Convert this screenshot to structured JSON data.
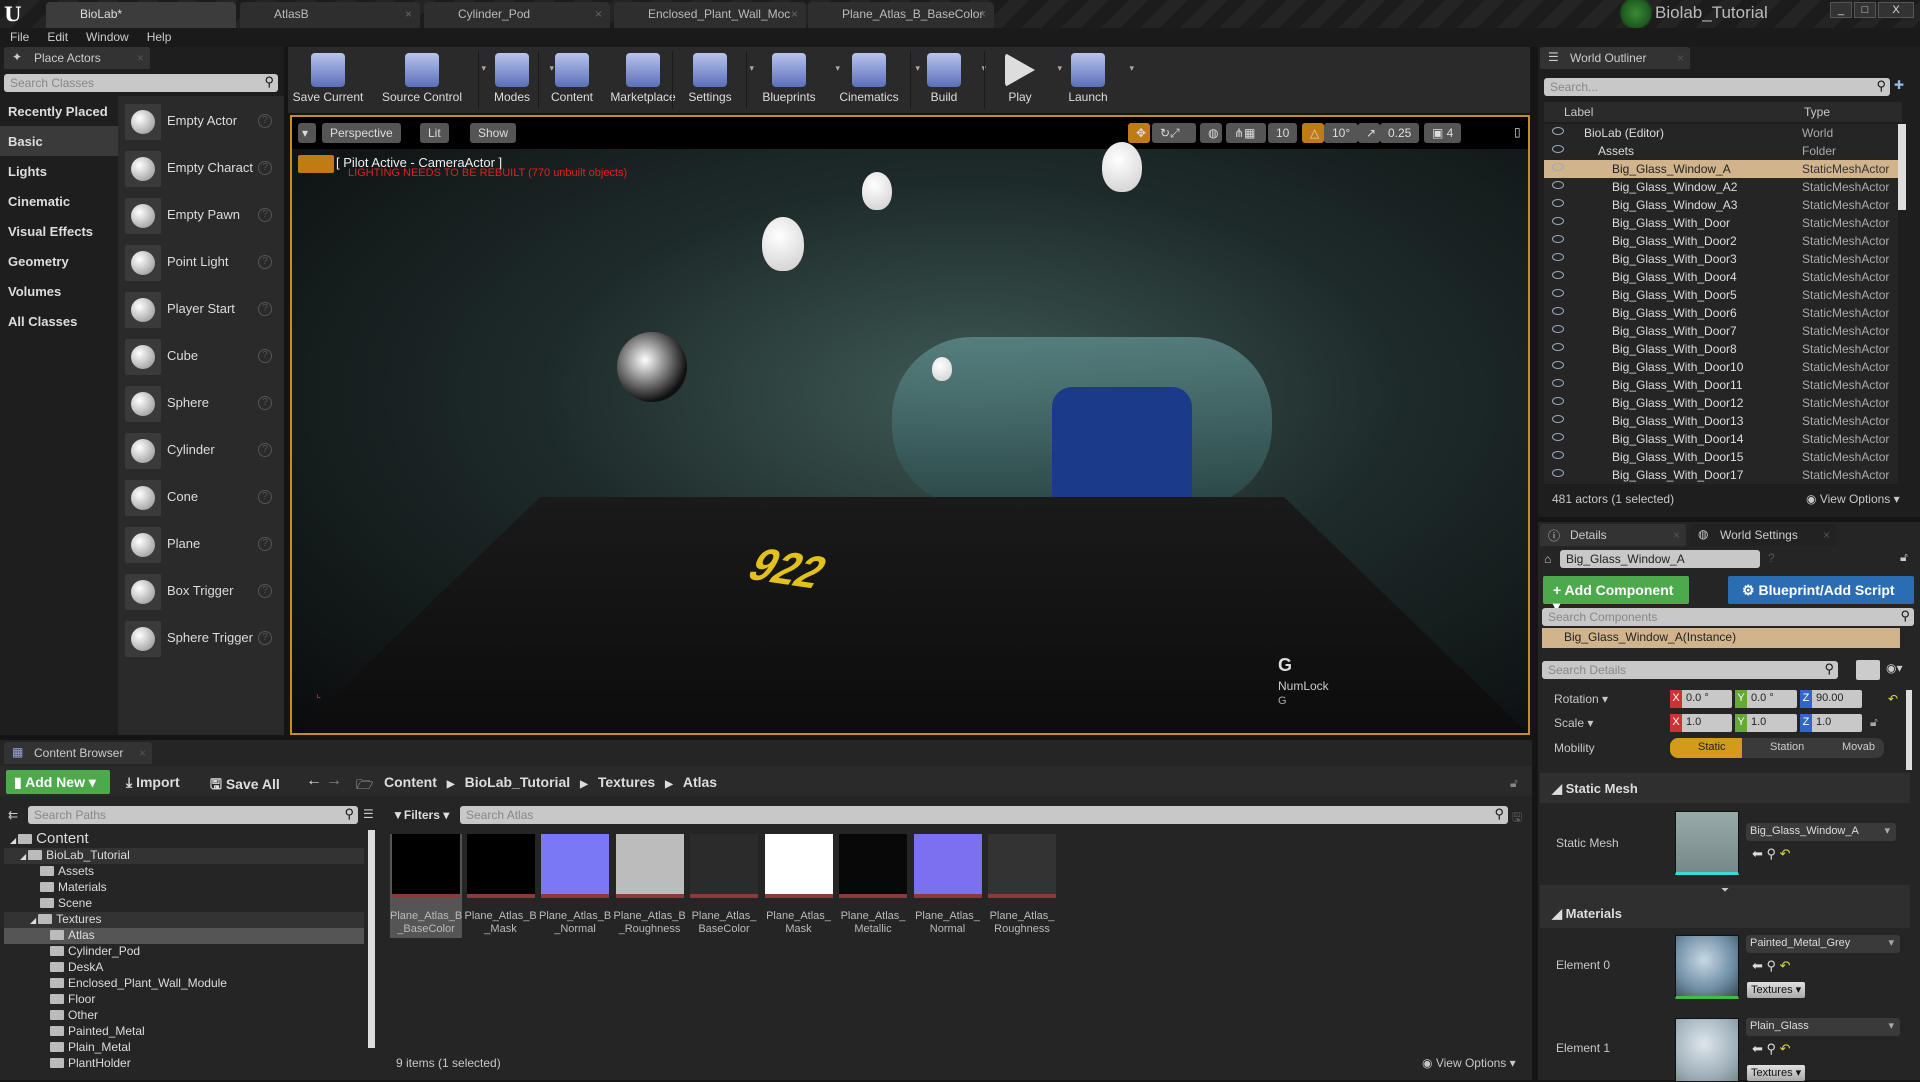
{
  "window": {
    "doc_tabs": [
      "BioLab*",
      "AtlasB",
      "Cylinder_Pod",
      "Enclosed_Plant_Wall_Moc",
      "Plane_Atlas_B_BaseColor"
    ],
    "project": "Biolab_Tutorial",
    "controls": [
      "_",
      "□",
      "X"
    ]
  },
  "menu": [
    "File",
    "Edit",
    "Window",
    "Help"
  ],
  "place_actors": {
    "tab": "Place Actors",
    "search_placeholder": "Search Classes",
    "categories": [
      "Recently Placed",
      "Basic",
      "Lights",
      "Cinematic",
      "Visual Effects",
      "Geometry",
      "Volumes",
      "All Classes"
    ],
    "selected_category": "Basic",
    "actors": [
      "Empty Actor",
      "Empty Charact",
      "Empty Pawn",
      "Point Light",
      "Player Start",
      "Cube",
      "Sphere",
      "Cylinder",
      "Cone",
      "Plane",
      "Box Trigger",
      "Sphere Trigger"
    ]
  },
  "toolbar": [
    "Save Current",
    "Source Control",
    "Modes",
    "Content",
    "Marketplace",
    "Settings",
    "Blueprints",
    "Cinematics",
    "Build",
    "Play",
    "Launch"
  ],
  "viewport": {
    "view_mode": "Perspective",
    "lighting": "Lit",
    "show": "Show",
    "grid_snap": "10",
    "rot_snap": "10°",
    "scale_snap": "0.25",
    "cam_speed": "4",
    "pilot": "[ Pilot Active - CameraActor ]",
    "warning": "LIGHTING NEEDS TO BE REBUILT (770 unbuilt objects)",
    "key_big": "G",
    "key_label": "NumLock",
    "key_small": "G",
    "border_color": "#c2901e"
  },
  "outliner": {
    "tab": "World Outliner",
    "search_placeholder": "Search...",
    "col_label": "Label",
    "col_type": "Type",
    "rows": [
      {
        "label": "BioLab (Editor)",
        "type": "World",
        "indent": 0
      },
      {
        "label": "Assets",
        "type": "Folder",
        "indent": 1
      },
      {
        "label": "Big_Glass_Window_A",
        "type": "StaticMeshActor",
        "indent": 2,
        "selected": true
      },
      {
        "label": "Big_Glass_Window_A2",
        "type": "StaticMeshActor",
        "indent": 2
      },
      {
        "label": "Big_Glass_Window_A3",
        "type": "StaticMeshActor",
        "indent": 2
      },
      {
        "label": "Big_Glass_With_Door",
        "type": "StaticMeshActor",
        "indent": 2
      },
      {
        "label": "Big_Glass_With_Door2",
        "type": "StaticMeshActor",
        "indent": 2
      },
      {
        "label": "Big_Glass_With_Door3",
        "type": "StaticMeshActor",
        "indent": 2
      },
      {
        "label": "Big_Glass_With_Door4",
        "type": "StaticMeshActor",
        "indent": 2
      },
      {
        "label": "Big_Glass_With_Door5",
        "type": "StaticMeshActor",
        "indent": 2
      },
      {
        "label": "Big_Glass_With_Door6",
        "type": "StaticMeshActor",
        "indent": 2
      },
      {
        "label": "Big_Glass_With_Door7",
        "type": "StaticMeshActor",
        "indent": 2
      },
      {
        "label": "Big_Glass_With_Door8",
        "type": "StaticMeshActor",
        "indent": 2
      },
      {
        "label": "Big_Glass_With_Door10",
        "type": "StaticMeshActor",
        "indent": 2
      },
      {
        "label": "Big_Glass_With_Door11",
        "type": "StaticMeshActor",
        "indent": 2
      },
      {
        "label": "Big_Glass_With_Door12",
        "type": "StaticMeshActor",
        "indent": 2
      },
      {
        "label": "Big_Glass_With_Door13",
        "type": "StaticMeshActor",
        "indent": 2
      },
      {
        "label": "Big_Glass_With_Door14",
        "type": "StaticMeshActor",
        "indent": 2
      },
      {
        "label": "Big_Glass_With_Door15",
        "type": "StaticMeshActor",
        "indent": 2
      },
      {
        "label": "Big_Glass_With_Door17",
        "type": "StaticMeshActor",
        "indent": 2
      }
    ],
    "status": "481 actors (1 selected)",
    "view_options": "View Options"
  },
  "details": {
    "tab": "Details",
    "tab2": "World Settings",
    "name": "Big_Glass_Window_A",
    "add_component": "+ Add Component",
    "blueprint": "Blueprint/Add Script",
    "search_components": "Search Components",
    "instance": "Big_Glass_Window_A(Instance)",
    "search_details": "Search Details",
    "rotation": {
      "label": "Rotation",
      "x": "0.0 °",
      "y": "0.0 °",
      "z": "90.00"
    },
    "scale": {
      "label": "Scale",
      "x": "1.0",
      "y": "1.0",
      "z": "1.0"
    },
    "mobility": {
      "label": "Mobility",
      "options": [
        "Static",
        "Station",
        "Movab"
      ],
      "selected": "Static"
    },
    "static_mesh_section": "Static Mesh",
    "static_mesh_label": "Static Mesh",
    "static_mesh_value": "Big_Glass_Window_A",
    "materials_section": "Materials",
    "materials": [
      {
        "label": "Element 0",
        "value": "Painted_Metal_Grey",
        "button": "Textures"
      },
      {
        "label": "Element 1",
        "value": "Plain_Glass",
        "button": "Textures"
      }
    ]
  },
  "content_browser": {
    "tab": "Content Browser",
    "add_new": "Add New",
    "import": "Import",
    "save_all": "Save All",
    "breadcrumb": [
      "Content",
      "BioLab_Tutorial",
      "Textures",
      "Atlas"
    ],
    "search_paths": "Search Paths",
    "filters": "Filters",
    "search_assets": "Search Atlas",
    "tree": [
      {
        "label": "Content",
        "level": 0,
        "open": true
      },
      {
        "label": "BioLab_Tutorial",
        "level": 1,
        "open": true
      },
      {
        "label": "Assets",
        "level": 2
      },
      {
        "label": "Materials",
        "level": 2
      },
      {
        "label": "Scene",
        "level": 2
      },
      {
        "label": "Textures",
        "level": 2,
        "open": true
      },
      {
        "label": "Atlas",
        "level": 3,
        "selected": true
      },
      {
        "label": "Cylinder_Pod",
        "level": 3
      },
      {
        "label": "DeskA",
        "level": 3
      },
      {
        "label": "Enclosed_Plant_Wall_Module",
        "level": 3
      },
      {
        "label": "Floor",
        "level": 3
      },
      {
        "label": "Other",
        "level": 3
      },
      {
        "label": "Painted_Metal",
        "level": 3
      },
      {
        "label": "Plain_Metal",
        "level": 3
      },
      {
        "label": "PlantHolder",
        "level": 3
      }
    ],
    "assets": [
      {
        "name1": "Plane_Atlas_B",
        "name2": "_BaseColor",
        "selected": true,
        "color": "#000000"
      },
      {
        "name1": "Plane_Atlas_B",
        "name2": "_Mask",
        "color": "#000000"
      },
      {
        "name1": "Plane_Atlas_B",
        "name2": "_Normal",
        "color": "#7b78f5"
      },
      {
        "name1": "Plane_Atlas_B",
        "name2": "_Roughness",
        "color": "#bcbcbc"
      },
      {
        "name1": "Plane_Atlas_",
        "name2": "BaseColor",
        "color": "#2b2b2b"
      },
      {
        "name1": "Plane_Atlas_",
        "name2": "Mask",
        "color": "#ffffff"
      },
      {
        "name1": "Plane_Atlas_",
        "name2": "Metallic",
        "color": "#080808"
      },
      {
        "name1": "Plane_Atlas_",
        "name2": "Normal",
        "color": "#7b70ef"
      },
      {
        "name1": "Plane_Atlas_",
        "name2": "Roughness",
        "color": "#333333"
      }
    ],
    "status": "9 items (1 selected)",
    "view_options": "View Options"
  }
}
